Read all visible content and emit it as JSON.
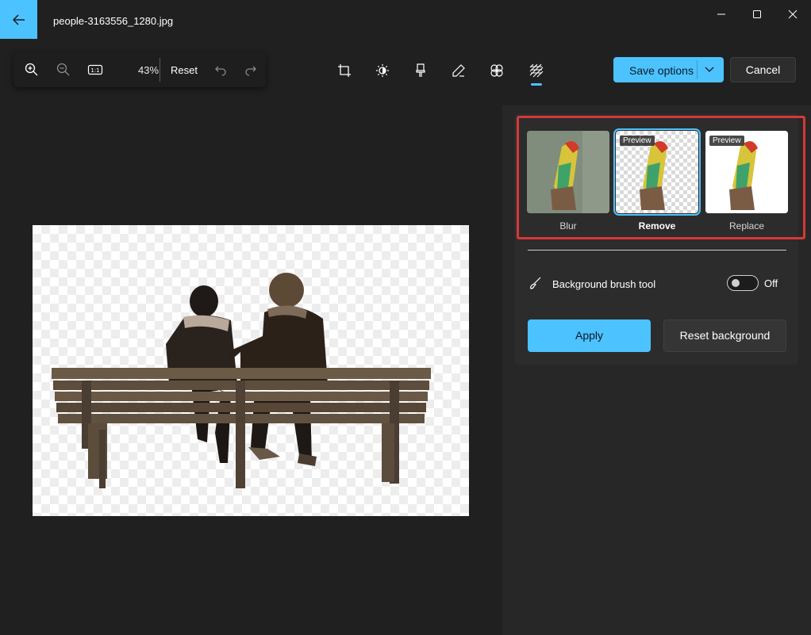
{
  "window": {
    "file_name": "people-3163556_1280.jpg"
  },
  "zoom_toolbar": {
    "zoom_level": "43%",
    "reset_label": "Reset",
    "actual_size_label": "1:1"
  },
  "actions": {
    "save_label": "Save options",
    "cancel_label": "Cancel"
  },
  "background_panel": {
    "options": [
      {
        "label": "Blur",
        "tag": ""
      },
      {
        "label": "Remove",
        "tag": "Preview"
      },
      {
        "label": "Replace",
        "tag": "Preview"
      }
    ],
    "brush_tool_label": "Background brush tool",
    "brush_tool_state": "Off",
    "apply_label": "Apply",
    "reset_background_label": "Reset background"
  },
  "colors": {
    "accent": "#4cc2ff",
    "highlight": "#d63838"
  }
}
